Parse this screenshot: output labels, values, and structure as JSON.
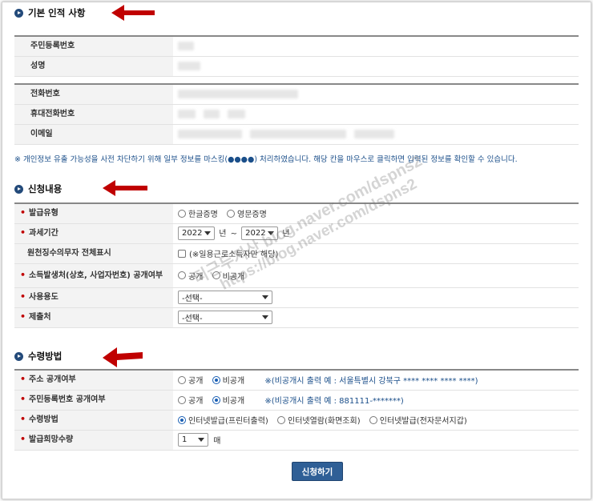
{
  "sections": {
    "basic": "기본 인적 사항",
    "apply": "신청내용",
    "receive": "수령방법"
  },
  "basic_fields": {
    "rrn": "주민등록번호",
    "name": "성명",
    "phone": "전화번호",
    "mobile": "휴대전화번호",
    "email": "이메일"
  },
  "notice": "※ 개인정보 유출 가능성을 사전 차단하기 위해 일부 정보를 마스킹(●●●●) 처리하였습니다. 해당 칸을 마우스로 클릭하면 입력된 정보를 확인할 수 있습니다.",
  "apply": {
    "issue_type_label": "발급유형",
    "issue_type_options": [
      "한글증명",
      "영문증명"
    ],
    "tax_period_label": "과세기간",
    "year_from": "2022",
    "year_to": "2022",
    "year_suffix": "년",
    "tilde": "~",
    "withholding_label": "원천징수의무자 전체표시",
    "withholding_note": "(※일용근로소득자만 해당)",
    "income_source_label": "소득발생처(상호, 사업자번호) 공개여부",
    "public_options": [
      "공개",
      "비공개"
    ],
    "purpose_label": "사용용도",
    "purpose_value": "-선택-",
    "submit_to_label": "제출처",
    "submit_to_value": "-선택-"
  },
  "receive": {
    "address_public_label": "주소 공개여부",
    "address_note": "※(비공개시 출력 예 : 서울특별시 강북구 **** **** **** ****)",
    "rrn_public_label": "주민등록번호 공개여부",
    "rrn_note": "※(비공개시 출력 예 : 881111-*******)",
    "method_label": "수령방법",
    "method_options": [
      "인터넷발급(프린터출력)",
      "인터넷열람(화면조회)",
      "인터넷발급(전자문서지갑)"
    ],
    "quantity_label": "발급희망수량",
    "quantity_value": "1",
    "quantity_unit": "매"
  },
  "submit_label": "신청하기",
  "watermark": {
    "line1": "티근두지산 blog.naver.com/dspns2",
    "line2": "https://blog.naver.com/dspns2"
  },
  "colors": {
    "accent": "#2f5f96",
    "arrow": "#c00000",
    "required": "#c00000",
    "note": "#1b4f8a"
  }
}
